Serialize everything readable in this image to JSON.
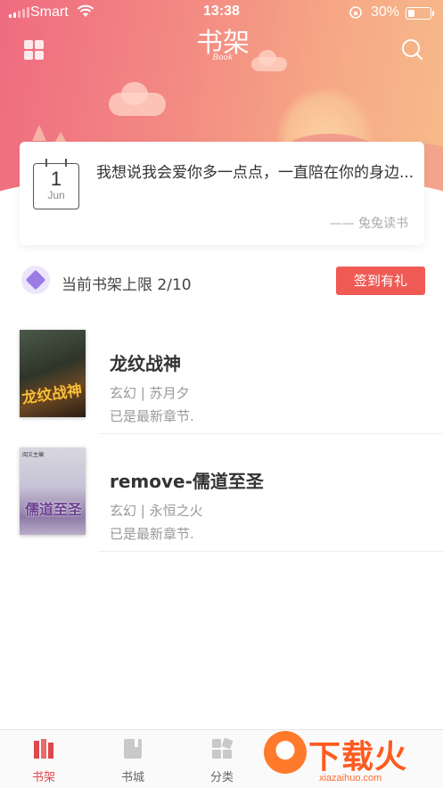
{
  "status_bar": {
    "carrier": "Smart",
    "time": "13:38",
    "battery_percent": "30%",
    "battery_level": 0.3
  },
  "header": {
    "logo_text": "书架",
    "logo_subtext": "Book"
  },
  "quote_card": {
    "calendar_day": "1",
    "calendar_month": "Jun",
    "text": "我想说我会爱你多一点点，一直陪在你的身边...",
    "source": "—— 兔兔读书"
  },
  "shelf_limit": {
    "label": "当前书架上限 2/10",
    "checkin_label": "签到有礼"
  },
  "books": [
    {
      "title": "龙纹战神",
      "meta": "玄幻 | 苏月夕",
      "status": "已是最新章节.",
      "cover_text": "龙纹战神"
    },
    {
      "title": "remove-儒道至圣",
      "meta": "玄幻 | 永恒之火",
      "status": "已是最新章节.",
      "cover_text": "儒道至圣",
      "cover_tag": "阅文主编"
    }
  ],
  "tabs": [
    {
      "label": "书架",
      "icon": "bookshelf-icon",
      "active": true
    },
    {
      "label": "书城",
      "icon": "bookstore-icon",
      "active": false
    },
    {
      "label": "分类",
      "icon": "category-icon",
      "active": false
    }
  ],
  "watermark": {
    "text": "下载火",
    "url": "xiazaihuo.com"
  },
  "colors": {
    "accent": "#ef5a55",
    "header_start": "#ef6b80",
    "header_end": "#f7bb8b",
    "tab_active": "#e0474b"
  }
}
